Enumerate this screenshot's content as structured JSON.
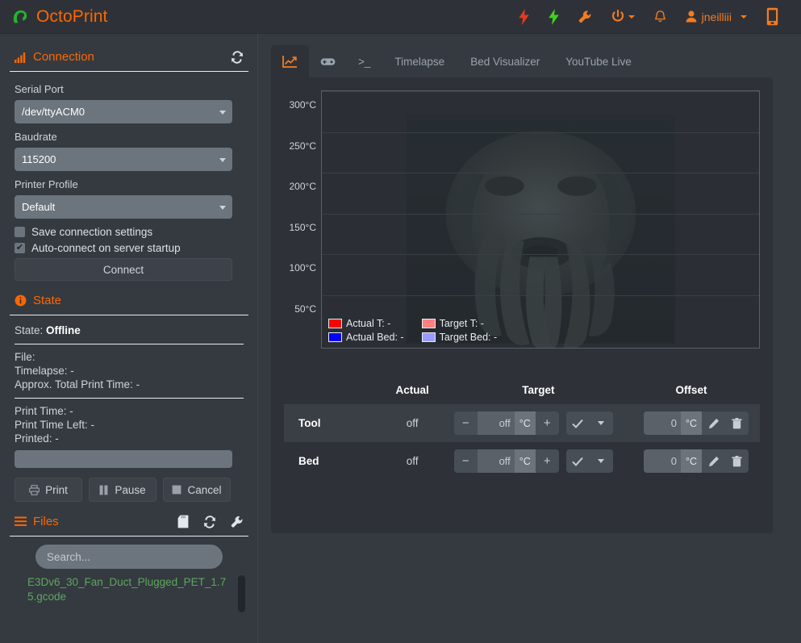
{
  "header": {
    "brand": "OctoPrint",
    "icons": [
      {
        "name": "power-off-bolt-icon",
        "glyph": "bolt",
        "color": "#e8391c"
      },
      {
        "name": "power-on-bolt-icon",
        "glyph": "bolt",
        "color": "#3fd41a"
      },
      {
        "name": "wrench-icon",
        "glyph": "wrench",
        "color": "#f47b20"
      },
      {
        "name": "power-icon",
        "glyph": "power",
        "color": "#f47b20"
      },
      {
        "name": "bell-icon",
        "glyph": "bell",
        "color": "#f47b20"
      }
    ],
    "user": "jneilliii",
    "mobile_icon": "mobile-icon"
  },
  "connection": {
    "title": "Connection",
    "refresh_label": "refresh",
    "serial_port_label": "Serial Port",
    "serial_port_value": "/dev/ttyACM0",
    "baudrate_label": "Baudrate",
    "baudrate_value": "115200",
    "profile_label": "Printer Profile",
    "profile_value": "Default",
    "save_settings_label": "Save connection settings",
    "save_settings_checked": false,
    "autoconnect_label": "Auto-connect on server startup",
    "autoconnect_checked": true,
    "connect_button": "Connect"
  },
  "state": {
    "title": "State",
    "state_label": "State:",
    "state_value": "Offline",
    "file_line": "File:",
    "timelapse_line": "Timelapse: -",
    "approx_total_line": "Approx. Total Print Time: -",
    "print_time_line": "Print Time: -",
    "print_time_left_line": "Print Time Left: -",
    "printed_line": "Printed: -",
    "progress_percent": 0,
    "print_button": "Print",
    "pause_button": "Pause",
    "cancel_button": "Cancel"
  },
  "files": {
    "title": "Files",
    "sd_icon": "sd-card-icon",
    "refresh_icon": "refresh-icon",
    "settings_icon": "wrench-icon",
    "search_placeholder": "Search...",
    "items": [
      {
        "name": "E3Dv6_30_Fan_Duct_Plugged_PET_1.75.gcode"
      }
    ]
  },
  "tabs": [
    {
      "id": "temperature",
      "label": "",
      "icon": "chart-line-icon",
      "active": true
    },
    {
      "id": "control",
      "label": "",
      "icon": "gamepad-icon",
      "active": false
    },
    {
      "id": "terminal",
      "label": ">_",
      "icon": "terminal-icon",
      "active": false
    },
    {
      "id": "timelapse",
      "label": "Timelapse",
      "icon": "",
      "active": false
    },
    {
      "id": "bed-visualizer",
      "label": "Bed Visualizer",
      "icon": "",
      "active": false
    },
    {
      "id": "youtube-live",
      "label": "YouTube Live",
      "icon": "",
      "active": false
    }
  ],
  "chart_data": {
    "type": "line",
    "title": "",
    "xlabel": "",
    "ylabel": "",
    "ylim": [
      25,
      310
    ],
    "yticks": [
      "50°C",
      "100°C",
      "150°C",
      "200°C",
      "250°C",
      "300°C"
    ],
    "ytick_values": [
      50,
      100,
      150,
      200,
      250,
      300
    ],
    "grid": true,
    "legend_position": "bottom-left",
    "series": [
      {
        "name": "Actual T: -",
        "color": "#ff0000",
        "values": []
      },
      {
        "name": "Target T: -",
        "color": "#ff8080",
        "values": []
      },
      {
        "name": "Actual Bed: -",
        "color": "#0000ff",
        "values": []
      },
      {
        "name": "Target Bed: -",
        "color": "#9a9aff",
        "values": []
      }
    ],
    "background_watermark": "davy-jones-face"
  },
  "temperature": {
    "columns": [
      "",
      "Actual",
      "Target",
      "Offset"
    ],
    "unit": "°C",
    "rows": [
      {
        "name": "Tool",
        "actual": "off",
        "target_value": "off",
        "offset_value": "0",
        "highlighted": true
      },
      {
        "name": "Bed",
        "actual": "off",
        "target_value": "off",
        "offset_value": "0",
        "highlighted": false
      }
    ],
    "buttons": {
      "decrement": "−",
      "increment": "+",
      "apply": "✔",
      "more": "caret-down",
      "edit": "pencil-icon",
      "delete": "trash-icon"
    }
  }
}
